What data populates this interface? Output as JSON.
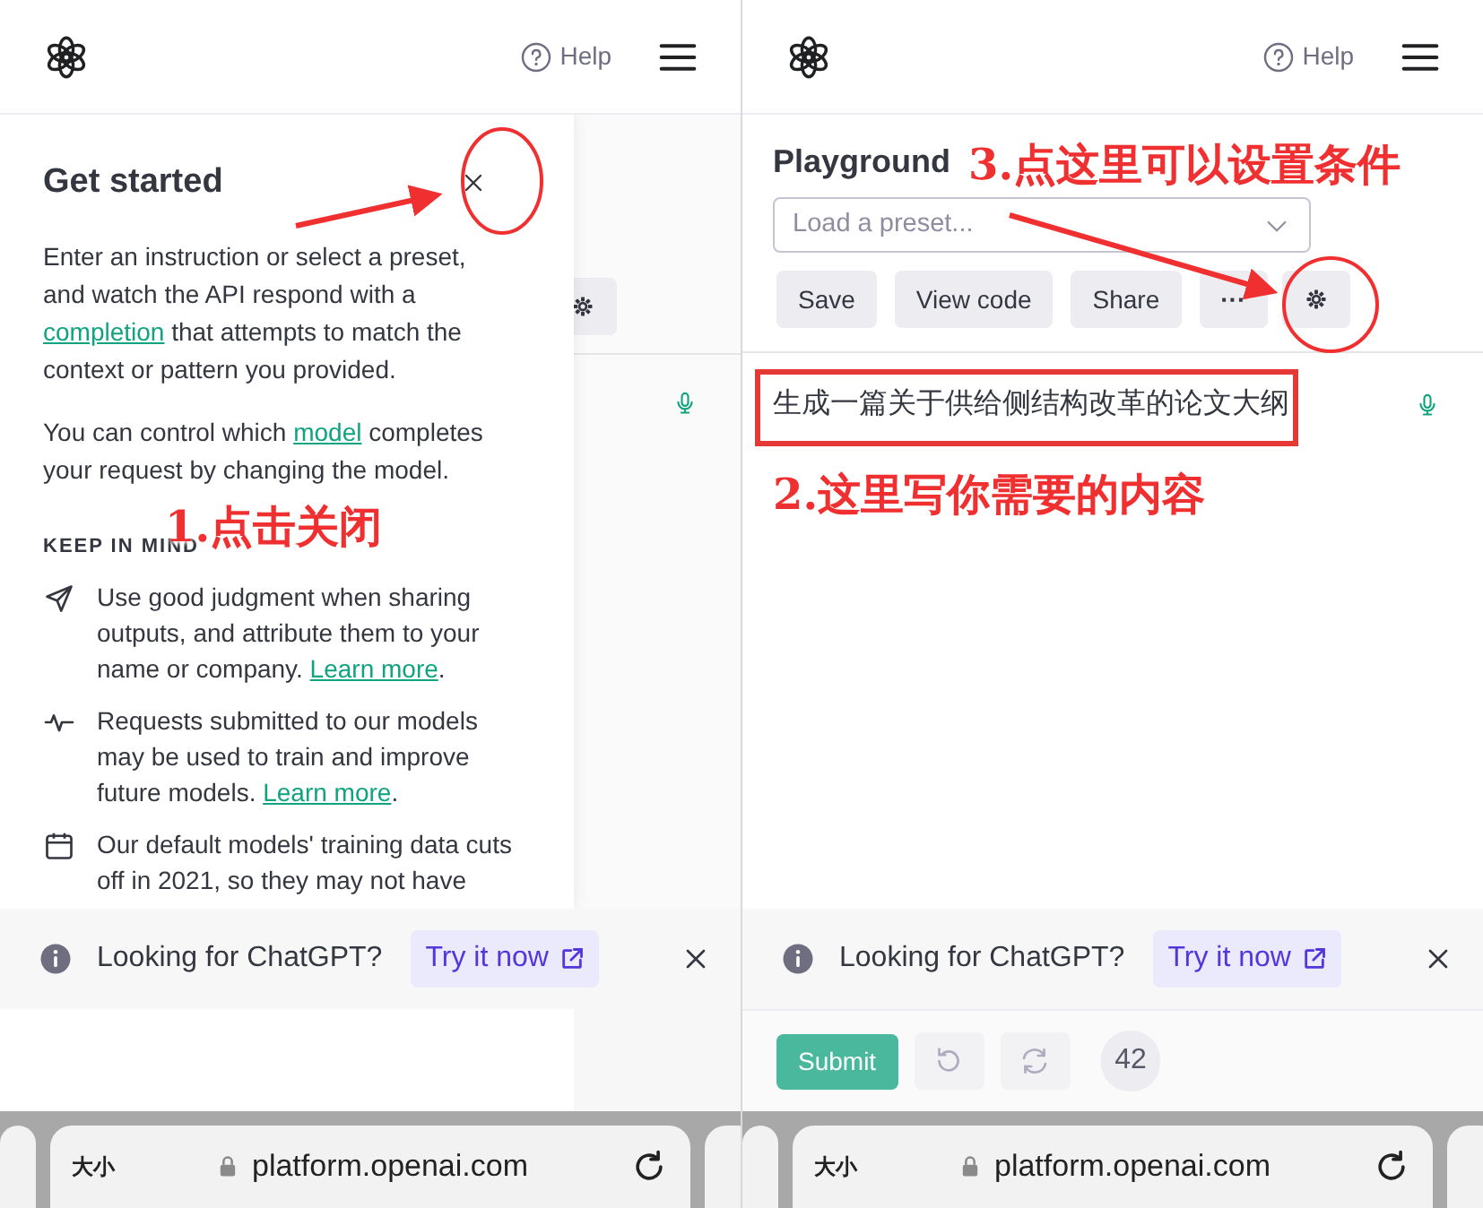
{
  "left_screen": {
    "header": {
      "help": "Help"
    },
    "drawer": {
      "title": "Get started",
      "paragraphs": [
        [
          {
            "text": "Enter an instruction or select a preset, and watch the API respond with a "
          },
          {
            "text": "completion",
            "link": true
          },
          {
            "text": " that attempts to match the context or pattern you provided."
          }
        ],
        [
          {
            "text": "You can control which "
          },
          {
            "text": "model",
            "link": true
          },
          {
            "text": " completes your request by changing the model."
          }
        ]
      ],
      "section_heading": "KEEP IN MIND",
      "notes": [
        {
          "parts": [
            {
              "text": "Use good judgment when sharing outputs, and attribute them to your name or company. "
            },
            {
              "text": "Learn more",
              "link": true
            },
            {
              "text": "."
            }
          ]
        },
        {
          "parts": [
            {
              "text": "Requests submitted to our models may be used to train and improve future models. "
            },
            {
              "text": "Learn more",
              "link": true
            },
            {
              "text": "."
            }
          ]
        },
        {
          "parts": [
            {
              "text": "Our default models' training data cuts off in 2021, so they may not have"
            }
          ]
        }
      ]
    },
    "banner": {
      "text": "Looking for ChatGPT?",
      "button": "Try it now"
    },
    "browser": {
      "text_size": "大小",
      "url": "platform.openai.com"
    },
    "annotation": "1.点击关闭"
  },
  "right_screen": {
    "header": {
      "help": "Help"
    },
    "title": "Playground",
    "preset": {
      "placeholder": "Load a preset..."
    },
    "buttons": [
      {
        "kind": "text",
        "label": "Save"
      },
      {
        "kind": "text",
        "label": "View code"
      },
      {
        "kind": "text",
        "label": "Share"
      },
      {
        "kind": "text",
        "label": "···"
      },
      {
        "kind": "gear"
      }
    ],
    "prompt": "生成一篇关于供给侧结构改革的论文大纲",
    "banner": {
      "text": "Looking for ChatGPT?",
      "button": "Try it now"
    },
    "submit": {
      "label": "Submit",
      "token_count": "42"
    },
    "browser": {
      "text_size": "大小",
      "url": "platform.openai.com"
    },
    "annotations": [
      "2.这里写你需要的内容",
      "3.点这里可以设置条件"
    ]
  }
}
